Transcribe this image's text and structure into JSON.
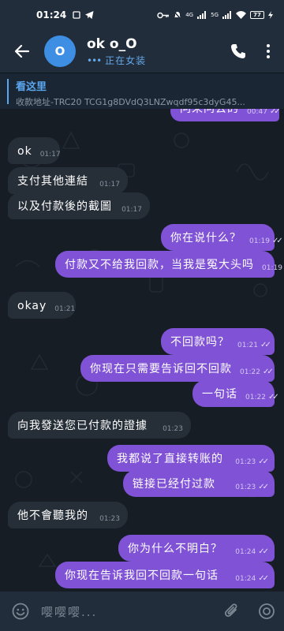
{
  "statusbar": {
    "time": "01:24",
    "network_label": "4G",
    "network2_label": "5G",
    "battery": "77"
  },
  "header": {
    "title": "ok o_O",
    "status": "正在女装",
    "avatar_letter": "O"
  },
  "pinned": {
    "title": "看这里",
    "text": "收款地址-TRC20   TCG1g8DVdQ3LNZwqdf95c3dyG45..."
  },
  "messages": [
    {
      "dir": "out",
      "text": "问来问去的",
      "time": "00:47",
      "read": "✓✓"
    },
    {
      "dir": "in",
      "text": "ok",
      "time": "01:17"
    },
    {
      "dir": "in",
      "text": "支付其他連結",
      "time": "01:17"
    },
    {
      "dir": "in",
      "text": "以及付款後的截圖",
      "time": "01:17"
    },
    {
      "dir": "out",
      "text": "你在说什么？",
      "time": "01:19",
      "read": "✓✓"
    },
    {
      "dir": "out",
      "text": "付款又不给我回款，当我是冤大头吗",
      "time": "01:19",
      "read": "✓✓"
    },
    {
      "dir": "in",
      "text": "okay",
      "time": "01:21"
    },
    {
      "dir": "out",
      "text": "不回款吗？",
      "time": "01:21",
      "read": "✓✓"
    },
    {
      "dir": "out",
      "text": "你现在只需要告诉回不回款",
      "time": "01:22",
      "read": "✓✓"
    },
    {
      "dir": "out",
      "text": "一句话",
      "time": "01:22",
      "read": "✓✓"
    },
    {
      "dir": "in",
      "text": "向我發送您已付款的證據",
      "time": "01:23"
    },
    {
      "dir": "out",
      "text": "我都说了直接转账的",
      "time": "01:23",
      "read": "✓✓"
    },
    {
      "dir": "out",
      "text": "链接已经付过款",
      "time": "01:23",
      "read": "✓✓"
    },
    {
      "dir": "in",
      "text": "他不會聽我的",
      "time": "01:23"
    },
    {
      "dir": "out",
      "text": "你为什么不明白？",
      "time": "01:24",
      "read": "✓✓"
    },
    {
      "dir": "out",
      "text": "你现在告诉我回不回款一句话",
      "time": "01:24",
      "read": "✓✓"
    }
  ],
  "input": {
    "value": "嘤嘤嘤..."
  },
  "icons": {
    "back": "back-arrow-icon",
    "call": "phone-icon",
    "menu": "more-vertical-icon",
    "emoji": "emoji-icon",
    "attach": "paperclip-icon",
    "camera": "camera-icon"
  },
  "colors": {
    "outgoing_bubble": "#7f52d6",
    "incoming_bubble": "#262e38",
    "header_bg": "#212d3b",
    "accent": "#5aa6ef"
  }
}
